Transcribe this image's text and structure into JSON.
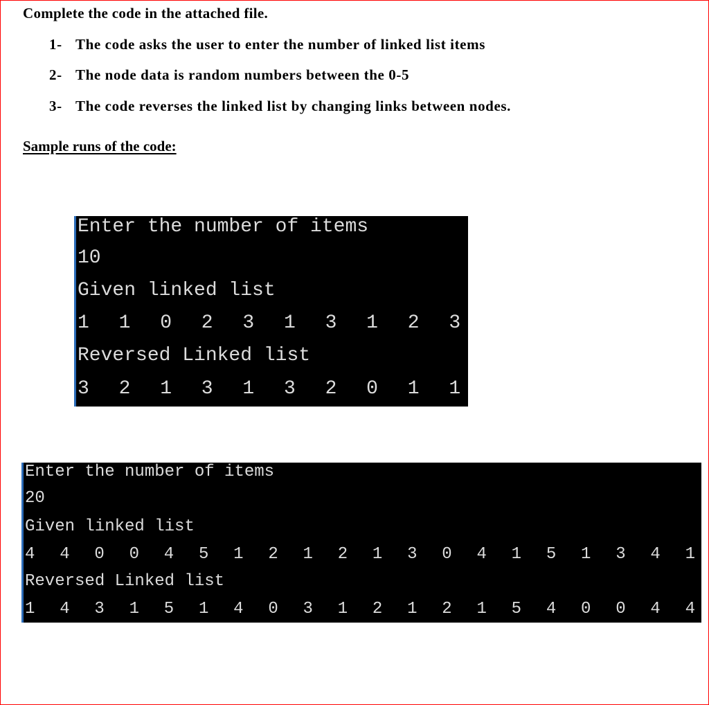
{
  "document": {
    "heading": "Complete the code in the attached file.",
    "requirements": [
      {
        "number": "1-",
        "text": "The code asks the user to enter the number of linked list items"
      },
      {
        "number": "2-",
        "text": "The node data is random numbers between the 0-5"
      },
      {
        "number": "3-",
        "text": "The code reverses the linked list by changing links between nodes."
      }
    ],
    "sample_heading": "Sample runs of the code:"
  },
  "sample_runs": [
    {
      "prompt": "Enter the number of items",
      "input": "10",
      "given_label": "Given linked list",
      "given_values": [
        "1",
        "1",
        "0",
        "2",
        "3",
        "1",
        "3",
        "1",
        "2",
        "3"
      ],
      "reversed_label": "Reversed Linked list",
      "reversed_values": [
        "3",
        "2",
        "1",
        "3",
        "1",
        "3",
        "2",
        "0",
        "1",
        "1"
      ]
    },
    {
      "prompt": "Enter the number of items",
      "input": "20",
      "given_label": "Given linked list",
      "given_values": [
        "4",
        "4",
        "0",
        "0",
        "4",
        "5",
        "1",
        "2",
        "1",
        "2",
        "1",
        "3",
        "0",
        "4",
        "1",
        "5",
        "1",
        "3",
        "4",
        "1"
      ],
      "reversed_label": "Reversed Linked list",
      "reversed_values": [
        "1",
        "4",
        "3",
        "1",
        "5",
        "1",
        "4",
        "0",
        "3",
        "1",
        "2",
        "1",
        "2",
        "1",
        "5",
        "4",
        "0",
        "0",
        "4",
        "4"
      ]
    }
  ],
  "colors": {
    "page_border": "#ff0000",
    "terminal_bg": "#000000",
    "terminal_text": "#dcdcdc",
    "terminal_edge": "#2b6cb8"
  }
}
